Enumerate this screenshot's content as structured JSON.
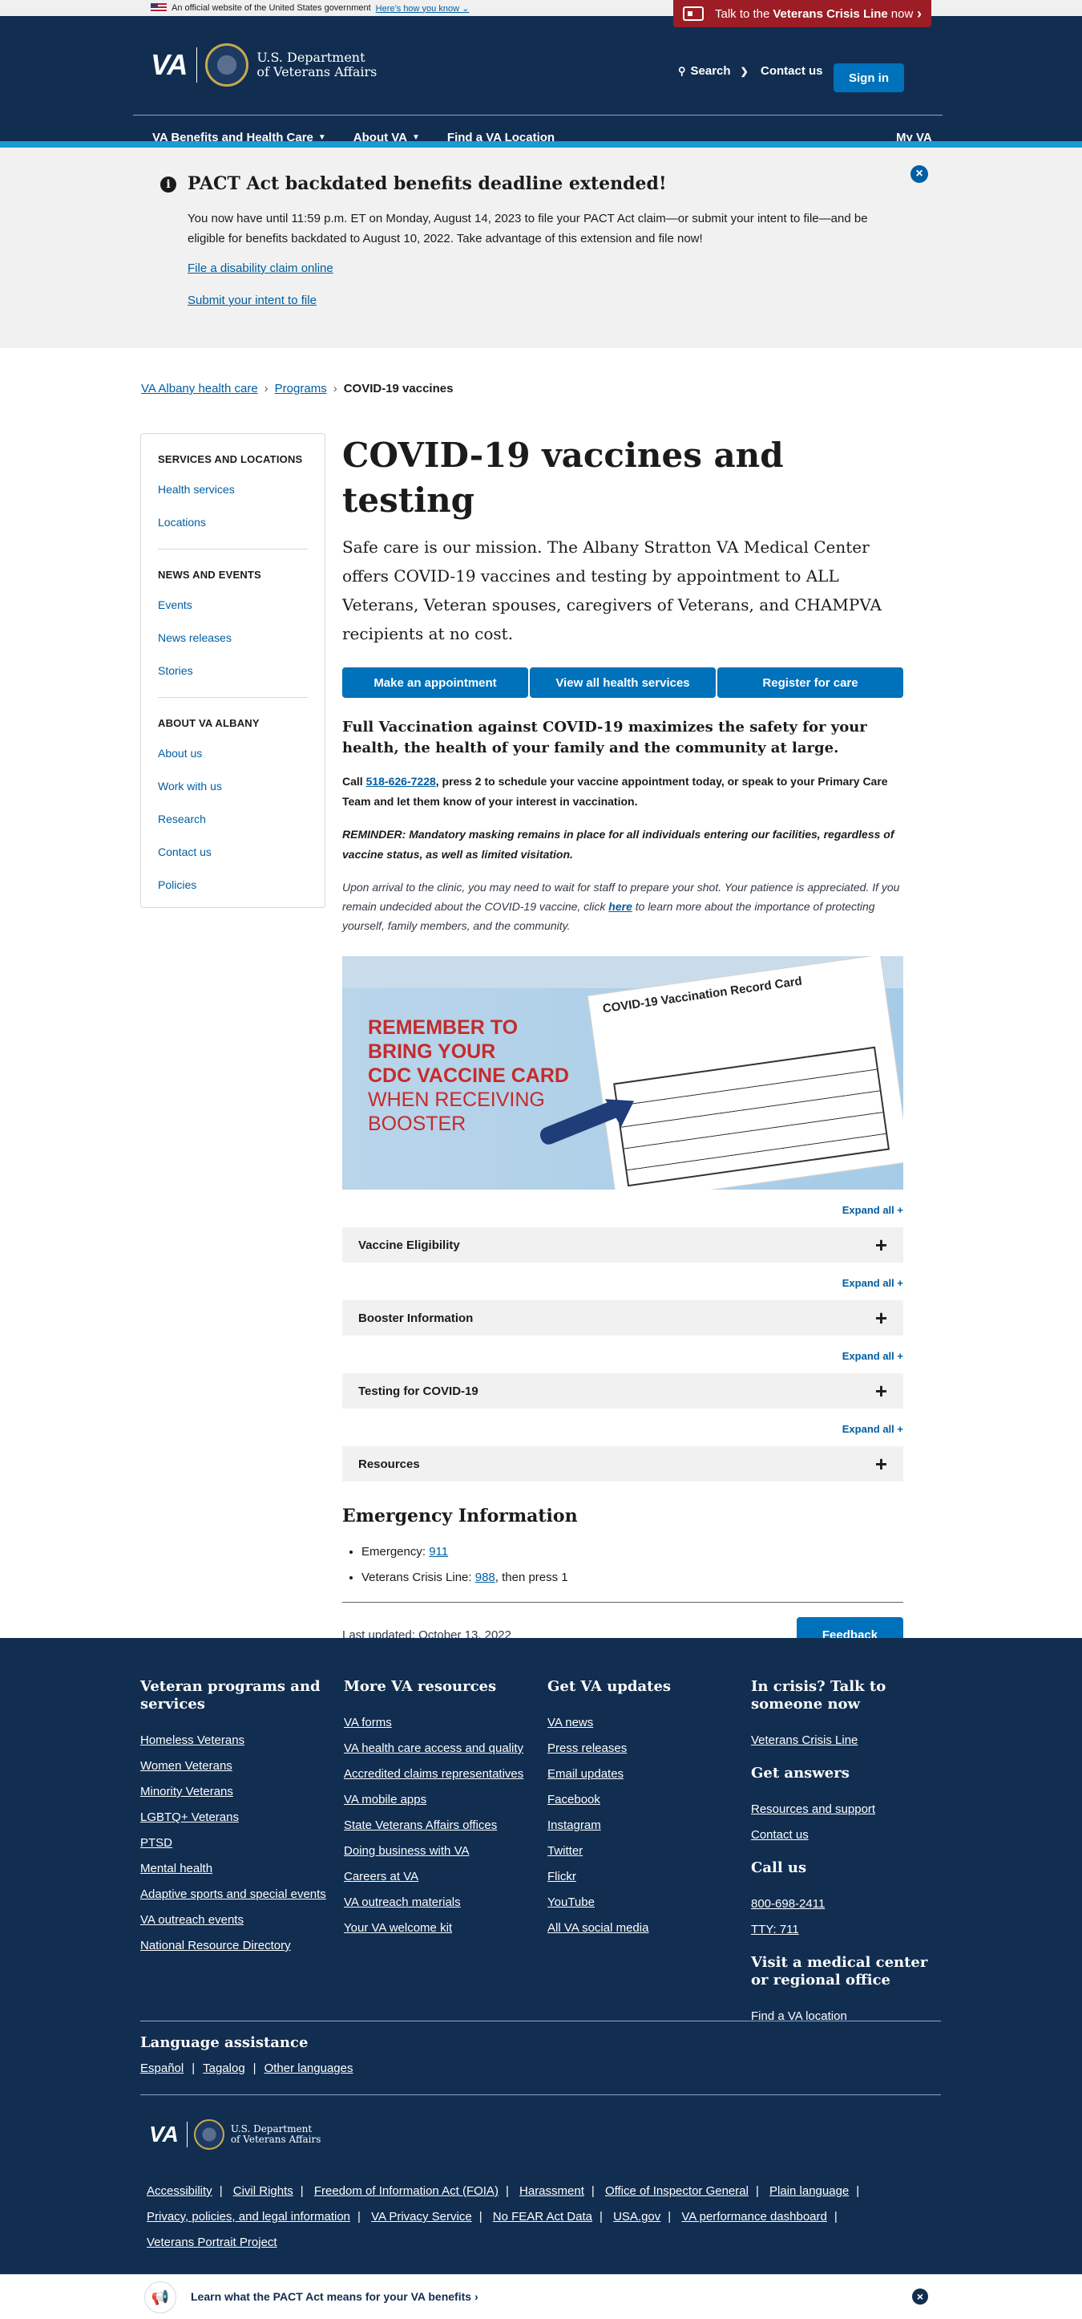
{
  "gov_banner": {
    "text": "An official website of the United States government",
    "how_link": "Here’s how you know"
  },
  "crisis_button": {
    "prefix": "Talk to the",
    "bold": "Veterans Crisis Line",
    "suffix": "now"
  },
  "header": {
    "logo_va": "VA",
    "dept_line1": "U.S. Department",
    "dept_line2": "of Veterans Affairs",
    "search": "Search",
    "contact": "Contact us",
    "signin": "Sign in",
    "nav": [
      "VA Benefits and Health Care",
      "About VA",
      "Find a VA Location"
    ],
    "myva": "My VA"
  },
  "alert": {
    "title": "PACT Act backdated benefits deadline extended!",
    "body": "You now have until 11:59 p.m. ET on Monday, August 14, 2023 to file your PACT Act claim—or submit your intent to file—and be eligible for benefits backdated to August 10, 2022. Take advantage of this extension and file now!",
    "link1": "File a disability claim online",
    "link2": "Submit your intent to file"
  },
  "breadcrumb": {
    "items": [
      "VA Albany health care",
      "Programs"
    ],
    "current": "COVID-19 vaccines"
  },
  "sidebar": {
    "sections": [
      {
        "title": "SERVICES AND LOCATIONS",
        "links": [
          "Health services",
          "Locations"
        ]
      },
      {
        "title": "NEWS AND EVENTS",
        "links": [
          "Events",
          "News releases",
          "Stories"
        ]
      },
      {
        "title": "ABOUT VA ALBANY",
        "links": [
          "About us",
          "Work with us",
          "Research",
          "Contact us",
          "Policies"
        ]
      }
    ]
  },
  "main": {
    "title": "COVID-19 vaccines and testing",
    "intro": "Safe care is our mission. The Albany Stratton VA Medical Center offers COVID-19 vaccines and testing by appointment to ALL Veterans, Veteran spouses, caregivers of Veterans, and CHAMPVA recipients at no cost.",
    "ctas": [
      "Make an appointment",
      "View all health services",
      "Register for care"
    ],
    "full_vacc": "Full Vaccination against COVID-19 maximizes the safety for your health, the health of your family and the community at large.",
    "call_pre": "Call ",
    "call_phone": "518-626-7228",
    "call_post": ", press 2 to schedule your vaccine appointment today, or speak to your Primary Care Team and let them know of your interest in  vaccination.",
    "reminder": "REMINDER: Mandatory masking remains in place for all individuals entering our facilities, regardless of vaccine status, as well as limited visitation.",
    "arrival_pre": "Upon arrival to the clinic, you may need to wait for staff to prepare your shot. Your patience is appreciated.  If you remain undecided about the COVID-19 vaccine, click ",
    "arrival_link": "here",
    "arrival_post": " to learn more about the importance of protecting yourself, family members, and the community.",
    "image": {
      "line1": "REMEMBER TO",
      "line2": "BRING YOUR",
      "line3": "CDC VACCINE CARD",
      "line4": "WHEN RECEIVING",
      "line5": "BOOSTER",
      "card_title": "COVID-19 Vaccination Record Card"
    },
    "expand_all": "Expand all +",
    "accordions": [
      "Vaccine Eligibility",
      "Booster Information",
      "Testing for COVID-19",
      "Resources"
    ],
    "emergency_title": "Emergency Information",
    "emergency_label": "Emergency: ",
    "emergency_number": "911",
    "crisis_label": "Veterans Crisis Line: ",
    "crisis_number": "988",
    "crisis_suffix": ", then press 1",
    "last_updated": "Last updated: October 13, 2022",
    "feedback": "Feedback"
  },
  "footer": {
    "columns": [
      {
        "title": "Veteran programs and services",
        "links": [
          "Homeless Veterans",
          "Women Veterans",
          "Minority Veterans",
          "LGBTQ+ Veterans",
          "PTSD",
          "Mental health",
          "Adaptive sports and special events",
          "VA outreach events",
          "National Resource Directory"
        ]
      },
      {
        "title": "More VA resources",
        "links": [
          "VA forms",
          "VA health care access and quality",
          "Accredited claims representatives",
          "VA mobile apps",
          "State Veterans Affairs offices",
          "Doing business with VA",
          "Careers at VA",
          "VA outreach materials",
          "Your VA welcome kit"
        ]
      },
      {
        "title": "Get VA updates",
        "links": [
          "VA news",
          "Press releases",
          "Email updates",
          "Facebook",
          "Instagram",
          "Twitter",
          "Flickr",
          "YouTube",
          "All VA social media"
        ]
      }
    ],
    "crisis_title": "In crisis? Talk to someone now",
    "crisis_link": "Veterans Crisis Line",
    "answers_title": "Get answers",
    "answers_links": [
      "Resources and support",
      "Contact us"
    ],
    "call_title": "Call us",
    "call_links": [
      "800-698-2411",
      "TTY: 711"
    ],
    "visit_title": "Visit a medical center or regional office",
    "visit_link": "Find a VA location",
    "lang_title": "Language assistance",
    "lang_links": [
      "Español",
      "Tagalog",
      "Other languages"
    ],
    "legal_links": [
      "Accessibility",
      "Civil Rights",
      "Freedom of Information Act (FOIA)",
      "Harassment",
      "Office of Inspector General",
      "Plain language",
      "Privacy, policies, and legal information",
      "VA Privacy Service",
      "No FEAR Act Data",
      "USA.gov",
      "VA performance dashboard",
      "Veterans Portrait Project"
    ]
  },
  "pact_banner": {
    "text": "Learn what the PACT Act means for your VA benefits ›"
  }
}
